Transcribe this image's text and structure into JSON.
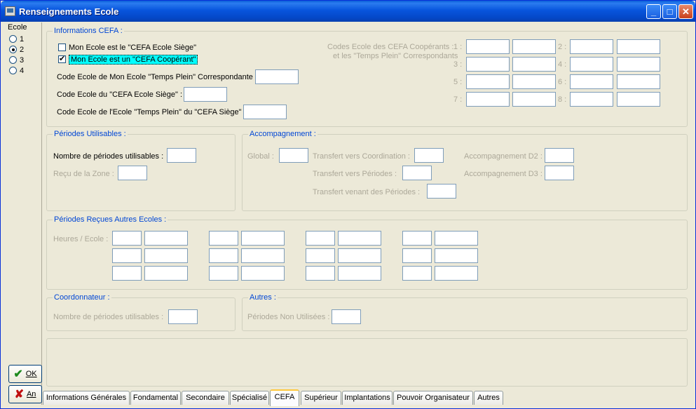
{
  "window": {
    "title": "Renseignements Ecole"
  },
  "left": {
    "ecole_label": "Ecole",
    "radios": [
      {
        "label": "1",
        "checked": false
      },
      {
        "label": "2",
        "checked": true
      },
      {
        "label": "3",
        "checked": false
      },
      {
        "label": "4",
        "checked": false
      }
    ],
    "ok_label": "OK",
    "cancel_label": "An"
  },
  "cefa": {
    "legend": "Informations CEFA :",
    "cb_siege": "Mon Ecole est le \"CEFA Ecole Siège\"",
    "cb_cooperant": "Mon Ecole est un \"CEFA Coopérant\"",
    "lbl_temps_plein": "Code Ecole de Mon Ecole \"Temps Plein\" Correspondante :",
    "lbl_siege": "Code Ecole du \"CEFA Ecole Siège\" :",
    "lbl_siege_tp": "Code Ecole de l'Ecole \"Temps Plein\" du \"CEFA Siège\" :",
    "coop_line1": "Codes Ecole des CEFA Coopérants :",
    "coop_line2": "et les \"Temps Plein\" Correspondants",
    "nums": [
      "1 :",
      "2 :",
      "3 :",
      "4 :",
      "5 :",
      "6 :",
      "7 :",
      "8 :"
    ]
  },
  "periodes": {
    "legend": "Périodes Utilisables :",
    "nombre": "Nombre de périodes utilisables  :",
    "recu": "Reçu de la Zone :"
  },
  "accomp": {
    "legend": "Accompagnement :",
    "global": "Global :",
    "coord": "Transfert vers Coordination :",
    "vers_periodes": "Transfert vers Périodes :",
    "venant": "Transfert venant des  Périodes :",
    "d2": "Accompagnement D2 :",
    "d3": "Accompagnement D3 :"
  },
  "autres_ecoles": {
    "legend": "Périodes Reçues Autres Ecoles :",
    "heures": "Heures / Ecole :"
  },
  "coordonnateur": {
    "legend": "Coordonnateur :",
    "nombre": "Nombre de périodes utilisables  :"
  },
  "autres": {
    "legend": "Autres :",
    "non_utilisees": "Périodes Non Utilisées :"
  },
  "tabs": [
    "Informations Générales",
    "Fondamental",
    "Secondaire",
    "Spécialisé",
    "CEFA",
    "Supérieur",
    "Implantations",
    "Pouvoir Organisateur",
    "Autres"
  ],
  "active_tab": "CEFA"
}
